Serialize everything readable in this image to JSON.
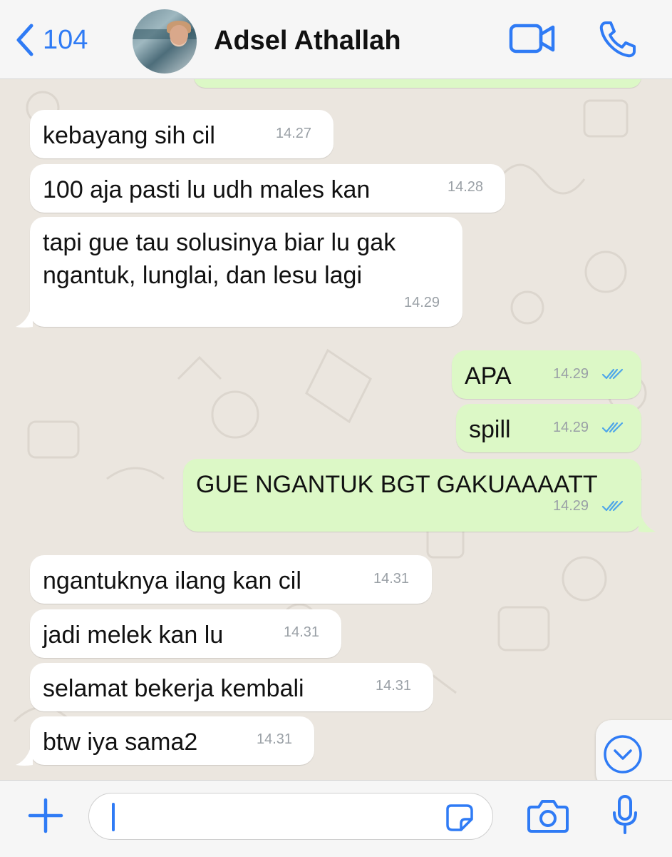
{
  "header": {
    "back_count": "104",
    "contact_name": "Adsel Athallah",
    "back_icon": "chevron-left-icon",
    "video_icon": "video-camera-icon",
    "call_icon": "phone-icon"
  },
  "messages": [
    {
      "dir": "in",
      "text": "kebayang sih cil",
      "time": "14.27"
    },
    {
      "dir": "in",
      "text": "100 aja pasti lu udh males kan",
      "time": "14.28"
    },
    {
      "dir": "in",
      "text": "tapi gue tau solusinya biar lu gak\nngantuk, lunglai, dan lesu lagi",
      "time": "14.29"
    },
    {
      "dir": "out",
      "text": "APA",
      "time": "14.29",
      "status": "read"
    },
    {
      "dir": "out",
      "text": "spill",
      "time": "14.29",
      "status": "read"
    },
    {
      "dir": "out",
      "text": "GUE NGANTUK BGT GAKUAAAATT",
      "time": "14.29",
      "status": "read"
    },
    {
      "dir": "in",
      "text": "ngantuknya ilang kan cil",
      "time": "14.31"
    },
    {
      "dir": "in",
      "text": "jadi melek kan lu",
      "time": "14.31"
    },
    {
      "dir": "in",
      "text": "selamat bekerja kembali",
      "time": "14.31"
    },
    {
      "dir": "in",
      "text": "btw iya sama2",
      "time": "14.31"
    }
  ],
  "composer": {
    "input_value": "",
    "plus_icon": "plus-icon",
    "sticker_icon": "sticker-icon",
    "camera_icon": "camera-icon",
    "mic_icon": "microphone-icon"
  },
  "colors": {
    "accent": "#2f7bf5",
    "incoming_bubble": "#ffffff",
    "outgoing_bubble": "#dcf8c6",
    "chat_background": "#ebe6df",
    "read_ticks": "#4fa6e9"
  }
}
